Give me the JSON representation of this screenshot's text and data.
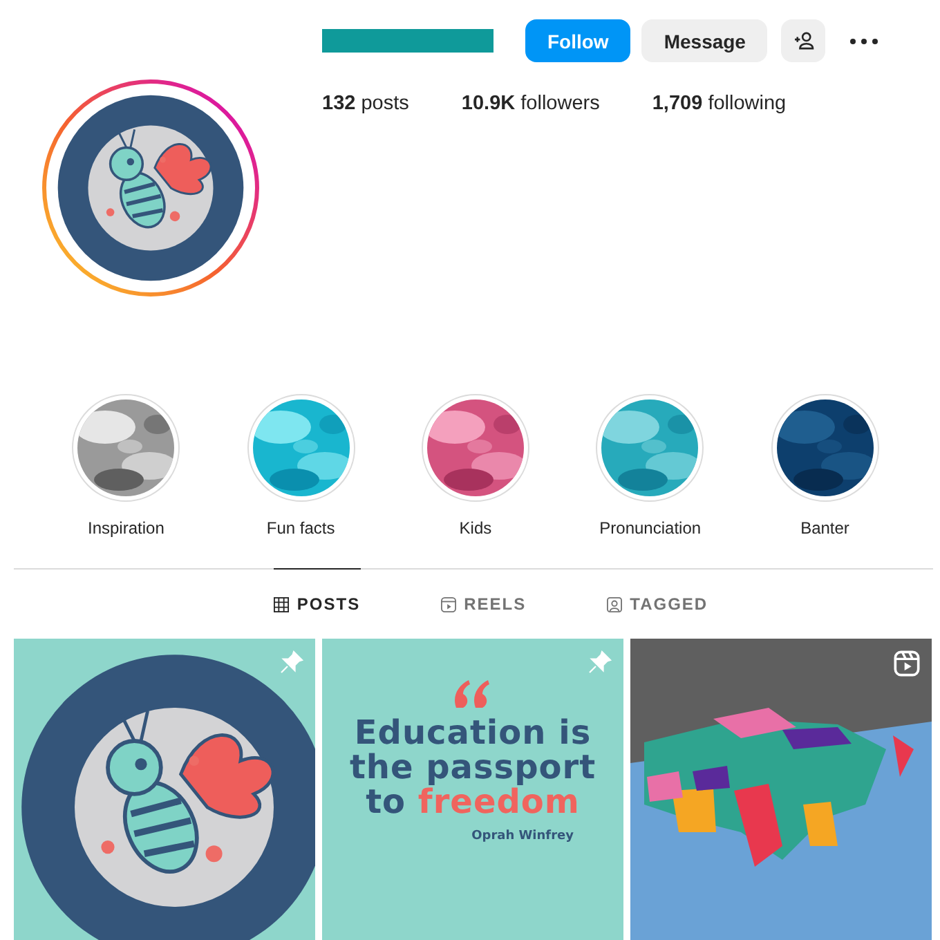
{
  "profile": {
    "buttons": [
      {
        "label": "Follow",
        "kind": "primary"
      },
      {
        "label": "Message",
        "kind": "secondary"
      }
    ],
    "stats": [
      {
        "value": "132",
        "label": "posts"
      },
      {
        "value": "10.9K",
        "label": "followers"
      },
      {
        "value": "1,709",
        "label": "following"
      }
    ],
    "has_story": true
  },
  "highlights": [
    {
      "label": "Inspiration",
      "kind": "picture"
    },
    {
      "label": "Fun facts",
      "kind": "picture"
    },
    {
      "label": "Kids",
      "kind": "picture"
    },
    {
      "label": "Pronunciation",
      "kind": "picture"
    },
    {
      "label": "Banter",
      "kind": "picture"
    }
  ],
  "tabs": [
    {
      "label": "POSTS",
      "kind": "grid",
      "selected": true
    },
    {
      "label": "REELS",
      "kind": "reels",
      "selected": false
    },
    {
      "label": "TAGGED",
      "kind": "tagged",
      "selected": false
    }
  ],
  "posts": [
    {
      "kind": "logo",
      "pinned": true
    },
    {
      "kind": "quote",
      "pinned": true,
      "lines": [
        {
          "text": "Education is"
        },
        {
          "text": "the passport"
        },
        {
          "text": "to ",
          "emphasis": "freedom"
        }
      ],
      "author": "Oprah Winfrey"
    },
    {
      "kind": "reel",
      "pinned": false
    }
  ]
}
